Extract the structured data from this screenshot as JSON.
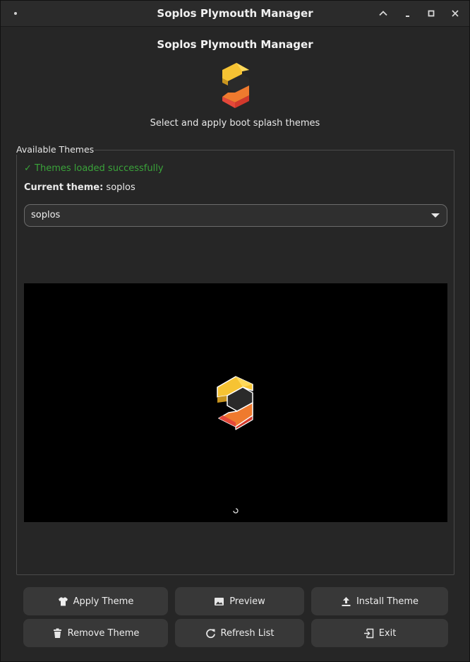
{
  "window": {
    "title": "Soplos Plymouth Manager"
  },
  "header": {
    "title": "Soplos Plymouth Manager",
    "subtitle": "Select and apply boot splash themes",
    "logo_icon": "soplos-logo-icon"
  },
  "themes_frame": {
    "label": "Available Themes",
    "status": "✓ Themes loaded successfully",
    "current_label": "Current theme:",
    "current_value": "soplos",
    "selected_theme": "soplos"
  },
  "preview": {
    "logo_icon": "soplos-logo-icon",
    "spinner_icon": "spinner-icon"
  },
  "buttons": {
    "apply": "Apply Theme",
    "preview": "Preview",
    "install": "Install Theme",
    "remove": "Remove Theme",
    "refresh": "Refresh List",
    "exit": "Exit"
  },
  "colors": {
    "background": "#262626",
    "button": "#383838",
    "status_ok": "#3aa33a",
    "logo_yellow": "#f6c333",
    "logo_orange": "#ef7a2e",
    "logo_red": "#e4483a"
  }
}
